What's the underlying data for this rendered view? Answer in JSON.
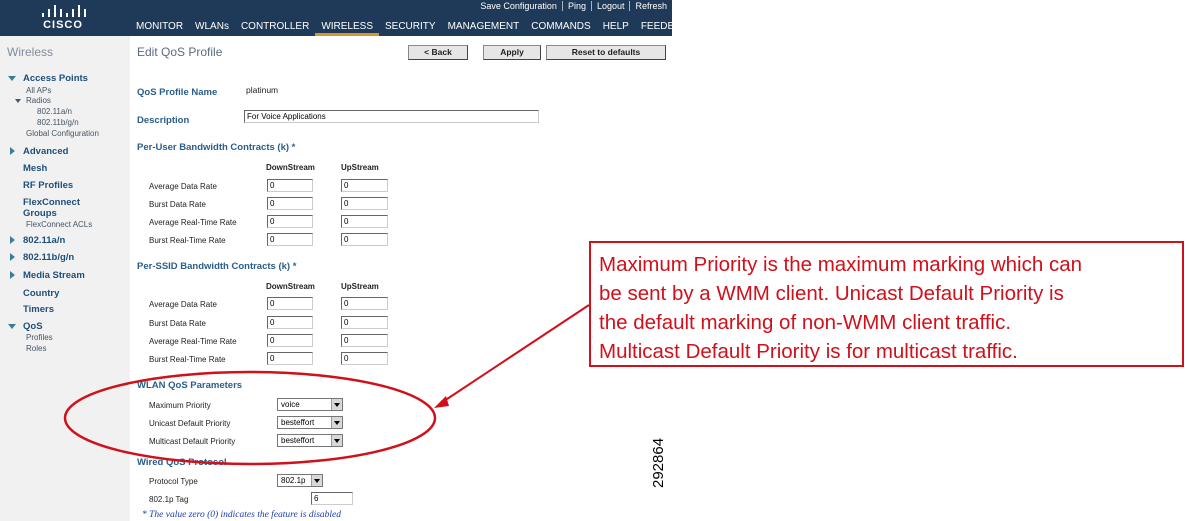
{
  "brand": {
    "logo_text": "CISCO"
  },
  "header": {
    "utility_links": [
      "Save Configuration",
      "Ping",
      "Logout",
      "Refresh"
    ],
    "nav": [
      "MONITOR",
      "WLANs",
      "CONTROLLER",
      "WIRELESS",
      "SECURITY",
      "MANAGEMENT",
      "COMMANDS",
      "HELP",
      "FEEDBACK"
    ],
    "active_nav": "WIRELESS"
  },
  "sidebar": {
    "title": "Wireless",
    "access_points": "Access Points",
    "all_aps": "All APs",
    "radios": "Radios",
    "radio_a": "802.11a/n",
    "radio_b": "802.11b/g/n",
    "global_config": "Global Configuration",
    "advanced": "Advanced",
    "mesh": "Mesh",
    "rf_profiles": "RF Profiles",
    "flexconnect_1": "FlexConnect",
    "flexconnect_2": "Groups",
    "flexconnect_acls": "FlexConnect ACLs",
    "dot11a": "802.11a/n",
    "dot11b": "802.11b/g/n",
    "media_stream": "Media Stream",
    "country": "Country",
    "timers": "Timers",
    "qos": "QoS",
    "profiles": "Profiles",
    "roles": "Roles"
  },
  "page": {
    "title": "Edit QoS Profile",
    "buttons": {
      "back": "< Back",
      "apply": "Apply",
      "reset": "Reset to defaults"
    },
    "profile_name_label": "QoS Profile Name",
    "profile_name": "platinum",
    "description_label": "Description",
    "description": "For Voice Applications",
    "per_user": {
      "title": "Per-User Bandwidth Contracts (k) *",
      "col_down": "DownStream",
      "col_up": "UpStream",
      "rows": [
        {
          "label": "Average Data Rate",
          "down": "0",
          "up": "0"
        },
        {
          "label": "Burst Data Rate",
          "down": "0",
          "up": "0"
        },
        {
          "label": "Average Real-Time Rate",
          "down": "0",
          "up": "0"
        },
        {
          "label": "Burst Real-Time Rate",
          "down": "0",
          "up": "0"
        }
      ]
    },
    "per_ssid": {
      "title": "Per-SSID Bandwidth Contracts (k) *",
      "col_down": "DownStream",
      "col_up": "UpStream",
      "rows": [
        {
          "label": "Average Data Rate",
          "down": "0",
          "up": "0"
        },
        {
          "label": "Burst Data Rate",
          "down": "0",
          "up": "0"
        },
        {
          "label": "Average Real-Time Rate",
          "down": "0",
          "up": "0"
        },
        {
          "label": "Burst Real-Time Rate",
          "down": "0",
          "up": "0"
        }
      ]
    },
    "wlan_qos": {
      "title": "WLAN QoS Parameters",
      "max_priority_label": "Maximum Priority",
      "max_priority": "voice",
      "unicast_label": "Unicast Default Priority",
      "unicast": "besteffort",
      "multicast_label": "Multicast Default Priority",
      "multicast": "besteffort"
    },
    "wired_qos": {
      "title": "Wired QoS Protocol",
      "protocol_label": "Protocol Type",
      "protocol": "802.1p",
      "tag_label": "802.1p Tag",
      "tag": "6"
    },
    "footnote": "* The value zero (0) indicates the feature is disabled"
  },
  "annotation": {
    "lines": [
      "Maximum Priority is the maximum marking which can",
      "be sent by a WMM client.  Unicast Default Priority is",
      "the default marking of non-WMM client traffic.",
      "Multicast Default Priority is for multicast traffic."
    ],
    "figure_id": "292864",
    "color": "#d0101a"
  }
}
